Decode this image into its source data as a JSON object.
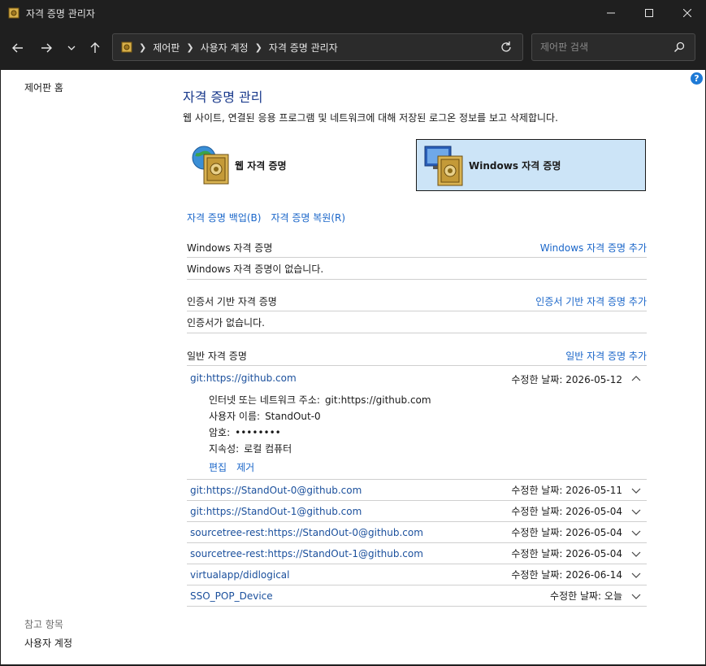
{
  "window": {
    "title": "자격 증명 관리자"
  },
  "breadcrumbs": [
    "제어판",
    "사용자 계정",
    "자격 증명 관리자"
  ],
  "search": {
    "placeholder": "제어판 검색"
  },
  "leftnav": {
    "home": "제어판 홈",
    "see_also": "참고 항목",
    "user_accounts": "사용자 계정"
  },
  "main": {
    "heading": "자격 증명 관리",
    "subtitle": "웹 사이트, 연결된 응용 프로그램 및 네트워크에 대해 저장된 로그온 정보를 보고 삭제합니다.",
    "web_credentials": "웹 자격 증명",
    "windows_credentials": "Windows 자격 증명",
    "backup": "자격 증명 백업(B)",
    "restore": "자격 증명 복원(R)"
  },
  "sections": {
    "windows": {
      "title": "Windows 자격 증명",
      "add": "Windows 자격 증명 추가",
      "empty": "Windows 자격 증명이 없습니다."
    },
    "certificate": {
      "title": "인증서 기반 자격 증명",
      "add": "인증서 기반 자격 증명 추가",
      "empty": "인증서가 없습니다."
    },
    "generic": {
      "title": "일반 자격 증명",
      "add": "일반 자격 증명 추가"
    }
  },
  "expanded": {
    "name": "git:https://github.com",
    "date": "수정한 날짜:  2026-05-12",
    "address_label": "인터넷 또는 네트워크 주소:",
    "address_value": "git:https://github.com",
    "username_label": "사용자 이름:",
    "username_value": "StandOut-0",
    "password_label": "암호:",
    "password_value": "••••••••",
    "persistence_label": "지속성:",
    "persistence_value": "로컬 컴퓨터",
    "edit": "편집",
    "remove": "제거"
  },
  "credentials": [
    {
      "name": "git:https://StandOut-0@github.com",
      "date": "수정한 날짜:  2026-05-11"
    },
    {
      "name": "git:https://StandOut-1@github.com",
      "date": "수정한 날짜:  2026-05-04"
    },
    {
      "name": "sourcetree-rest:https://StandOut-0@github.com",
      "date": "수정한 날짜:  2026-05-04"
    },
    {
      "name": "sourcetree-rest:https://StandOut-1@github.com",
      "date": "수정한 날짜:  2026-05-04"
    },
    {
      "name": "virtualapp/didlogical",
      "date": "수정한 날짜:  2026-06-14"
    },
    {
      "name": "SSO_POP_Device",
      "date": "수정한 날짜:  오늘"
    }
  ],
  "colors": {
    "accent": "#1a66c9",
    "selected_bg": "#cce4f7",
    "title_blue": "#1a3a8c"
  }
}
